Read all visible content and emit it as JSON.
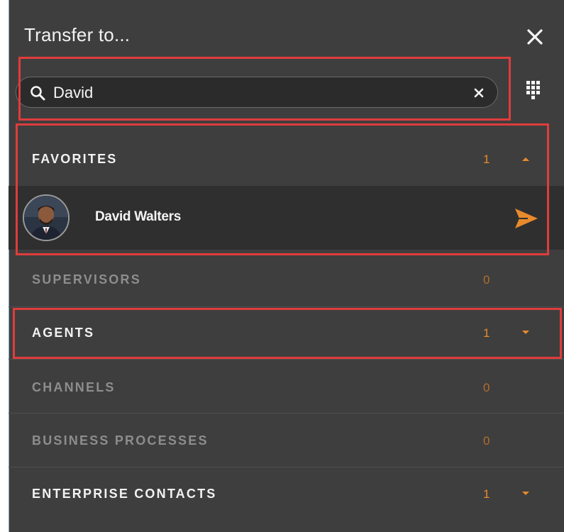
{
  "dialog": {
    "title": "Transfer to..."
  },
  "search": {
    "value": "David",
    "placeholder": ""
  },
  "sections": {
    "favorites": {
      "label": "FAVORITES",
      "count": "1",
      "state": "expanded"
    },
    "supervisors": {
      "label": "SUPERVISORS",
      "count": "0"
    },
    "agents": {
      "label": "AGENTS",
      "count": "1",
      "state": "collapsed"
    },
    "channels": {
      "label": "CHANNELS",
      "count": "0"
    },
    "business_processes": {
      "label": "BUSINESS PROCESSES",
      "count": "0"
    },
    "enterprise_contacts": {
      "label": "ENTERPRISE CONTACTS",
      "count": "1",
      "state": "collapsed"
    }
  },
  "favorites_contacts": [
    {
      "name": "David Walters"
    }
  ],
  "icons": {
    "close": "close-icon",
    "search": "search-icon",
    "clear": "clear-icon",
    "dialpad": "dialpad-icon",
    "send": "send-icon",
    "chevron_up": "chevron-up-icon",
    "chevron_down": "chevron-down-icon"
  },
  "colors": {
    "panel_bg": "#3e3e3e",
    "accent_orange": "#e88a2c",
    "highlight_red": "#e03c3c"
  }
}
